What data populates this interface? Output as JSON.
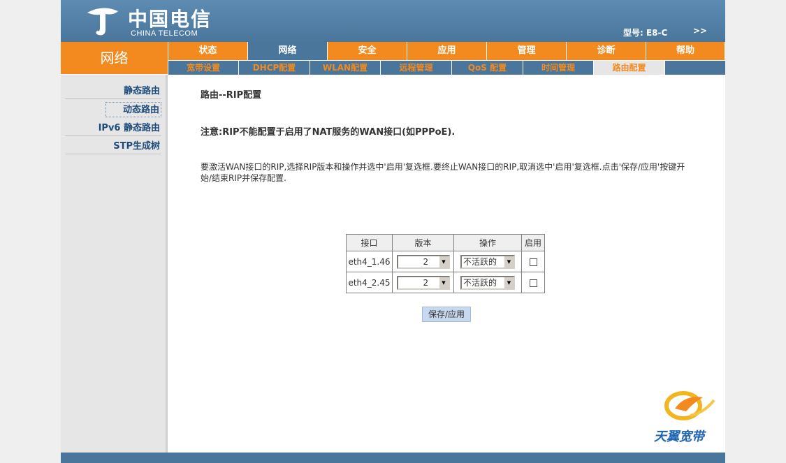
{
  "header": {
    "logo_cn": "中国电信",
    "logo_en": "CHINA TELECOM",
    "model_label": "型号: E8-C",
    "more_label": ">>"
  },
  "section_title": "网络",
  "main_tabs": [
    "状态",
    "网络",
    "安全",
    "应用",
    "管理",
    "诊断",
    "帮助"
  ],
  "active_main_tab": "网络",
  "sub_tabs": [
    "宽带设置",
    "DHCP配置",
    "WLAN配置",
    "远程管理",
    "QoS 配置",
    "时间管理",
    "路由配置"
  ],
  "active_sub_tab": "路由配置",
  "sidebar": {
    "items": [
      "静态路由",
      "动态路由",
      "IPv6 静态路由",
      "STP生成树"
    ],
    "active": "动态路由"
  },
  "content": {
    "title": "路由--RIP配置",
    "note": "注意:RIP不能配置于启用了NAT服务的WAN接口(如PPPoE).",
    "desc": "要激活WAN接口的RIP,选择RIP版本和操作并选中'启用'复选框.要终止WAN接口的RIP,取消选中'启用'复选框.点击'保存/应用'按键开始/结束RIP并保存配置."
  },
  "rip_table": {
    "headers": [
      "接口",
      "版本",
      "操作",
      "启用"
    ],
    "rows": [
      {
        "interface": "eth4_1.46",
        "version": "2",
        "operation": "不活跃的",
        "enabled": false
      },
      {
        "interface": "eth4_2.45",
        "version": "2",
        "operation": "不活跃的",
        "enabled": false
      }
    ]
  },
  "save_button": "保存/应用",
  "brand_label": "天翼宽带",
  "colors": {
    "header_blue": "#4a769c",
    "accent_orange": "#f28a1f",
    "sidebar_gray": "#e6e6e6",
    "sidebar_text": "#1f4b7a"
  }
}
